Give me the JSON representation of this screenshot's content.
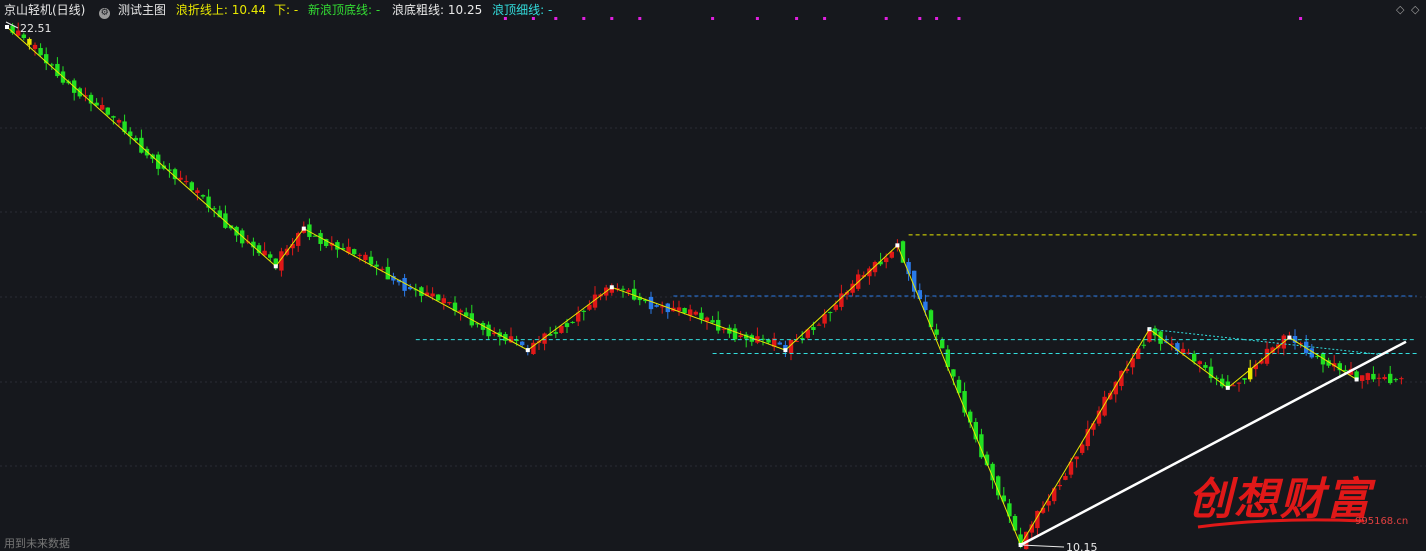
{
  "header": {
    "title": "京山轻机(日线)",
    "indicator_name": "测试主图",
    "wave_up_label": "浪折线上:",
    "wave_up_value": "10.44",
    "wave_down_label": "下:",
    "wave_down_value": "-",
    "new_top_label": "新浪顶底线:",
    "new_top_value": "-",
    "bottom_thick_label": "浪底粗线:",
    "bottom_thick_value": "10.25",
    "top_thin_label": "浪顶细线:",
    "top_thin_value": "-"
  },
  "footer": {
    "text": "用到未来数据"
  },
  "watermark": {
    "text": "创想财富",
    "url": "995168.cn"
  },
  "colors": {
    "background": "#16181d",
    "up_candle": "#e01818",
    "down_candle": "#22e022",
    "blue_candle": "#2a7ae8",
    "yellow_candle": "#e8e800",
    "zigzag": "#e8e800",
    "trendline": "#ffffff",
    "magenta_marks": "#e020e0"
  },
  "chart_data": {
    "type": "candlestick",
    "price_range": [
      10.15,
      22.51
    ],
    "labels": {
      "high": "22.51",
      "low": "10.15"
    },
    "wave_points": [
      {
        "i": 0,
        "p": 22.51
      },
      {
        "i": 48,
        "p": 16.8
      },
      {
        "i": 53,
        "p": 17.7
      },
      {
        "i": 93,
        "p": 14.8
      },
      {
        "i": 108,
        "p": 16.3
      },
      {
        "i": 139,
        "p": 14.8
      },
      {
        "i": 159,
        "p": 17.3
      },
      {
        "i": 181,
        "p": 10.15
      },
      {
        "i": 204,
        "p": 15.3
      },
      {
        "i": 218,
        "p": 13.9
      },
      {
        "i": 229,
        "p": 15.1
      },
      {
        "i": 241,
        "p": 14.1
      }
    ],
    "top_levels": [
      {
        "p": 17.55,
        "from": 161,
        "to": 241,
        "color": "#e8e800"
      },
      {
        "p": 16.09,
        "from": 119,
        "to": 241,
        "color": "#2a7ae8"
      },
      {
        "p": 15.05,
        "from": 73,
        "to": 241,
        "color": "#33dddd"
      },
      {
        "p": 14.72,
        "from": 126,
        "to": 241,
        "color": "#33dddd"
      }
    ]
  }
}
